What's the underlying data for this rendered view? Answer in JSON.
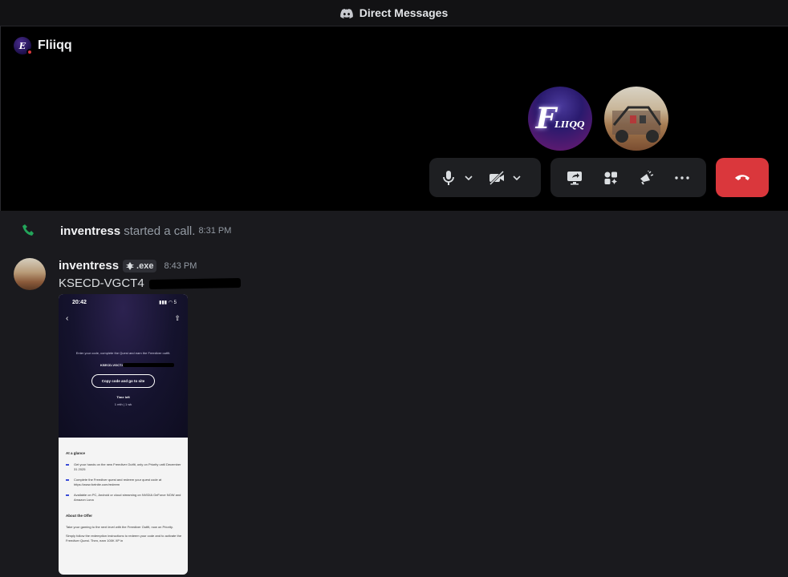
{
  "titlebar": {
    "title": "Direct Messages",
    "icon": "discord-logo-icon"
  },
  "call": {
    "user": "Fliiqq",
    "avatar1_text": "F",
    "avatar1_sub": "LIIQQ",
    "colors": {
      "end_call": "#da373c",
      "control_bg": "#1e1f22"
    }
  },
  "chat": {
    "system": {
      "user": "inventress",
      "text": "started a call.",
      "time": "8:31 PM"
    },
    "message": {
      "user": "inventress",
      "tag": ".exe",
      "time": "8:43 PM",
      "text": "KSECD-VGCT4"
    },
    "attachment": {
      "status_time": "20:42",
      "status_icons": "5",
      "subtitle": "Enter your code, complete the Quest and earn the Freediver outfit.",
      "code": "KSECD-VGCT4",
      "button": "Copy code and go to site",
      "time_left_label": "Time left",
      "time_left_value": "1 mth  |  1 wk",
      "at_glance": "At a glance",
      "bullet1": "Get your hands on the new Freediver Outfit, only on Priority until December 31 2025",
      "bullet2": "Complete the Freediver quest and redeem your quest code at https://www.fortnite.com/redeem",
      "bullet3": "Available on PC, Android or cloud streaming on NVIDIA GeForce NOW and Amazon Luna",
      "about": "About the Offer",
      "p1": "Take your gaming to the next level with the Freediver Outfit, now on Priority.",
      "p2": "Simply follow the redemption instructions to redeem your code and to activate the Freediver Quest. Then, earn 100K XP in"
    }
  }
}
